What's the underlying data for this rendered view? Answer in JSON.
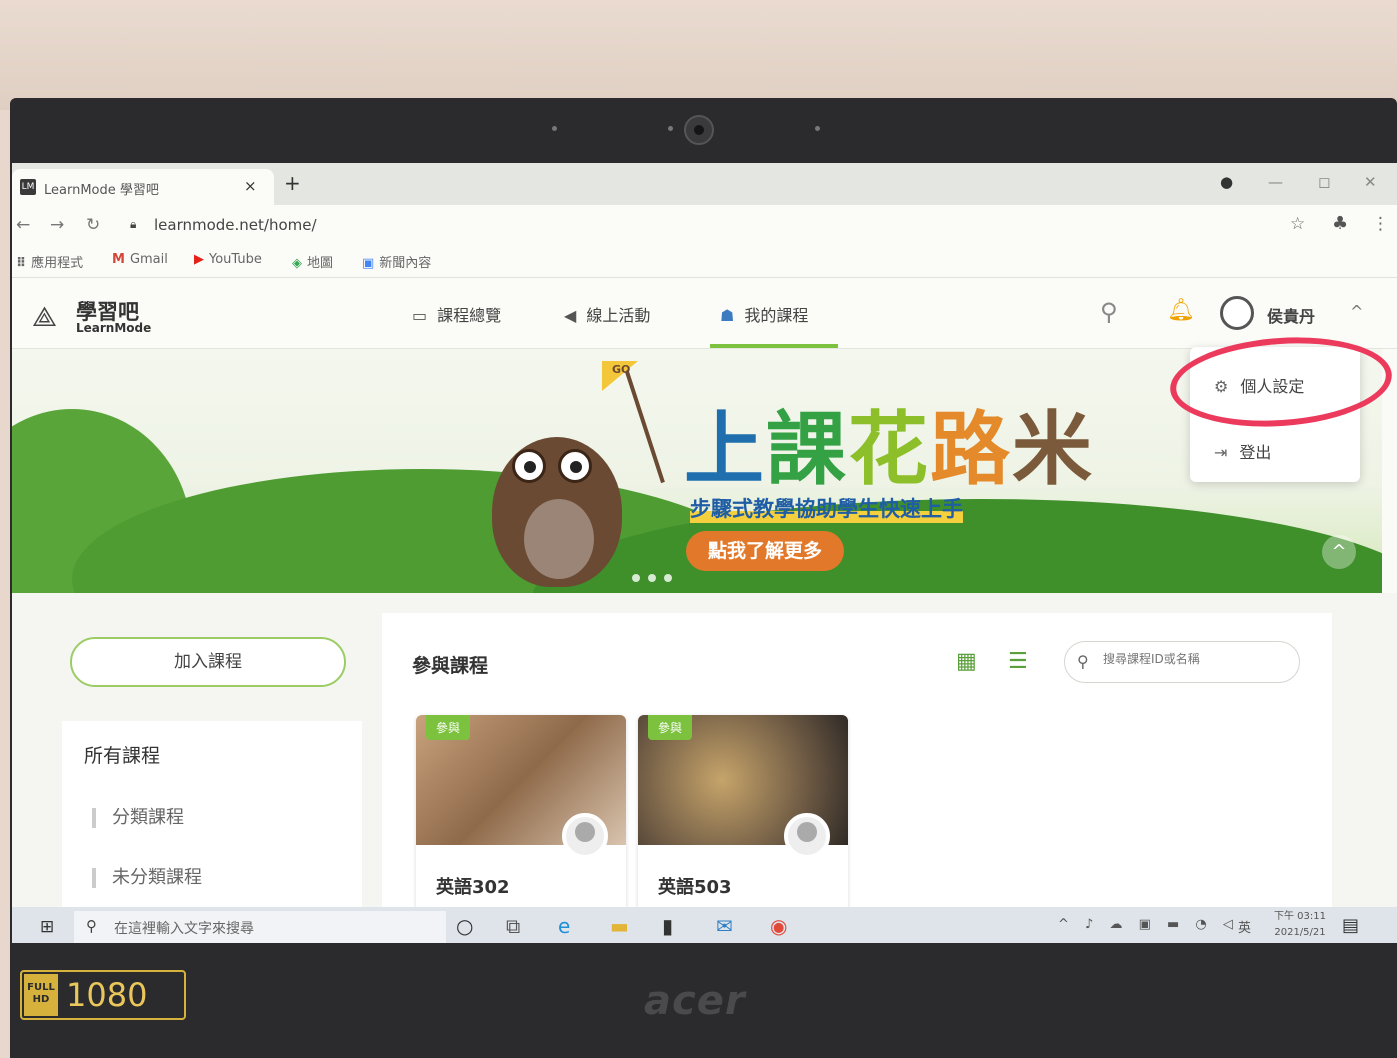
{
  "browser": {
    "tab_title": "LearnMode 學習吧",
    "tab_close": "×",
    "new_tab": "+",
    "url": "learnmode.net/home/",
    "bookmarks": [
      {
        "icon": "apps-icon",
        "glyph": "⠿",
        "label": "應用程式"
      },
      {
        "icon": "gmail-icon",
        "glyph": "M",
        "label": "Gmail"
      },
      {
        "icon": "youtube-icon",
        "glyph": "▶",
        "label": "YouTube"
      },
      {
        "icon": "maps-icon",
        "glyph": "◈",
        "label": "地圖"
      },
      {
        "icon": "news-icon",
        "glyph": "▣",
        "label": "新聞內容"
      }
    ]
  },
  "site": {
    "logo_cn": "學習吧",
    "logo_en": "LearnMode",
    "nav": [
      {
        "label": "課程總覽",
        "icon": "book-icon",
        "glyph": "▭"
      },
      {
        "label": "線上活動",
        "icon": "megaphone-icon",
        "glyph": "◀"
      },
      {
        "label": "我的課程",
        "icon": "student-icon",
        "glyph": "☗"
      }
    ],
    "user_name": "侯貴丹",
    "dropdown": {
      "settings": "個人設定",
      "logout": "登出"
    }
  },
  "banner": {
    "title_chars": [
      "上",
      "課",
      "花",
      "路",
      "米"
    ],
    "subtitle": "步驟式教學協助學生快速上手",
    "cta": "點我了解更多",
    "flag_text": "GO"
  },
  "sidebar": {
    "join_button": "加入課程",
    "category_title": "所有課程",
    "categories": [
      "分類課程",
      "未分類課程"
    ]
  },
  "main": {
    "section_title": "參與課程",
    "search_placeholder": "搜尋課程ID或名稱",
    "courses": [
      {
        "tag": "參與",
        "title": "英語302"
      },
      {
        "tag": "參與",
        "title": "英語503"
      }
    ]
  },
  "taskbar": {
    "search_placeholder": "在這裡輸入文字來搜尋",
    "time": "下午 03:11",
    "date": "2021/5/21",
    "ime": "英"
  },
  "laptop": {
    "hd_label": "FULL HD",
    "resolution": "1080",
    "brand": "acer"
  },
  "colors": {
    "accent_green": "#7dc23f",
    "annotation_red": "#ec3a5c",
    "banner_cta": "#e2792a"
  }
}
